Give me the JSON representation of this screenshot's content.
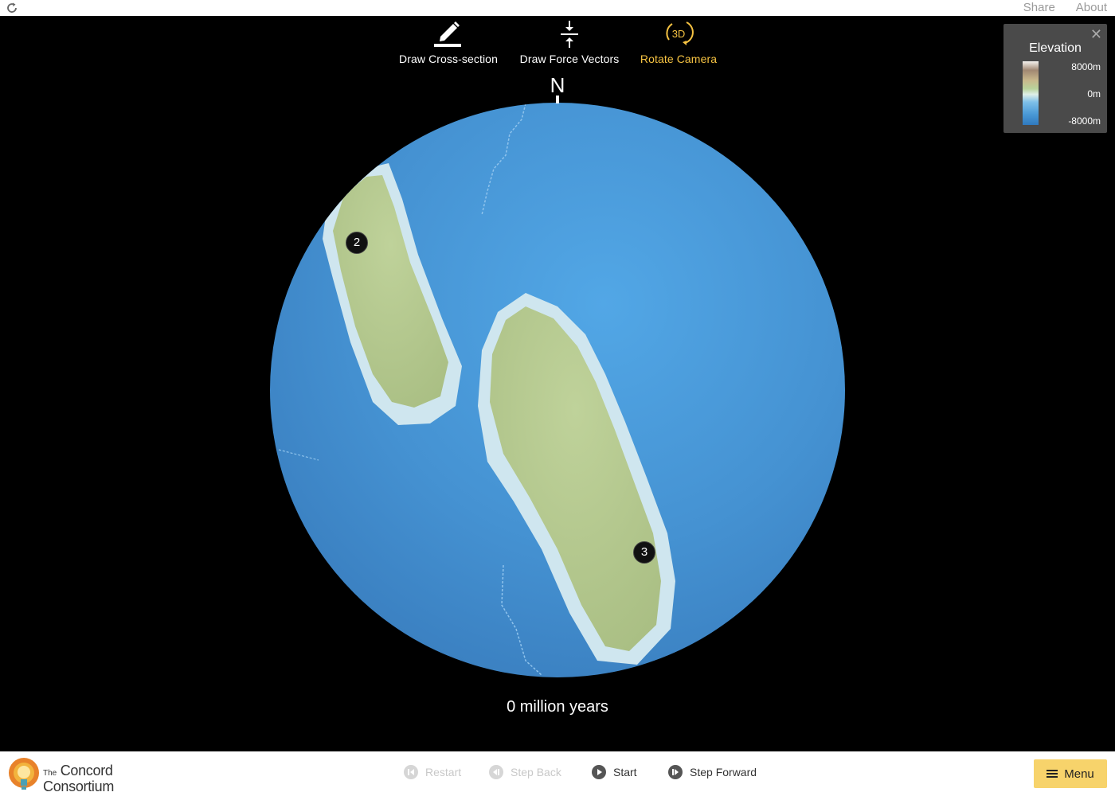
{
  "topbar": {
    "links": [
      "Share",
      "About"
    ]
  },
  "tools": [
    {
      "label": "Draw Cross-section",
      "icon": "pencil-icon",
      "active": false
    },
    {
      "label": "Draw Force Vectors",
      "icon": "compress-arrows-icon",
      "active": false
    },
    {
      "label": "Rotate Camera",
      "icon": "rotate-3d-icon",
      "icon_text": "3D",
      "active": true
    }
  ],
  "planet": {
    "north_label": "N",
    "plates": [
      "2",
      "3"
    ]
  },
  "legend": {
    "title": "Elevation",
    "max": "8000m",
    "mid": "0m",
    "min": "-8000m",
    "close": "✕"
  },
  "time": "0 million years",
  "logo": {
    "the": "The",
    "line1": "Concord",
    "line2": "Consortium"
  },
  "controls": {
    "restart": "Restart",
    "step_back": "Step Back",
    "start": "Start",
    "step_forward": "Step Forward"
  },
  "menu": {
    "label": "Menu"
  },
  "colors": {
    "accent": "#f5c242",
    "menu_bg": "#f7d36b",
    "ocean": "#4a95d6",
    "land": "#b6c98e"
  }
}
